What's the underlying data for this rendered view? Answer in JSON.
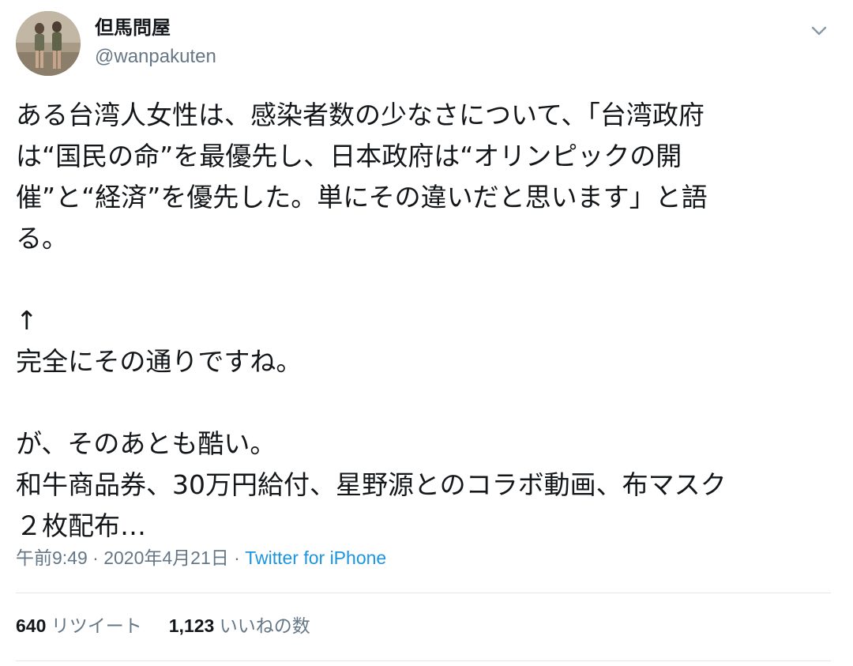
{
  "author": {
    "display_name": "但馬問屋",
    "handle": "@wanpakuten"
  },
  "tweet": {
    "lines": [
      "ある台湾人女性は、感染者数の少なさについて、「台湾政府",
      "は“国民の命”を最優先し、日本政府は“オリンピックの開",
      "催”と“経済”を優先した。単にその違いだと思います」と語",
      "る。",
      "",
      "↑",
      "完全にその通りですね。",
      "",
      "が、そのあとも酷い。",
      "和牛商品券、30万円給付、星野源とのコラボ動画、布マスク",
      "２枚配布…"
    ]
  },
  "meta": {
    "time": "午前9:49",
    "separator1": " · ",
    "date": "2020年4月21日",
    "separator2": " · ",
    "source": "Twitter for iPhone"
  },
  "stats": {
    "retweets_count": "640",
    "retweets_label": "リツイート",
    "likes_count": "1,123",
    "likes_label": "いいねの数"
  },
  "icons": {
    "caret": "chevron-down-icon"
  },
  "colors": {
    "text": "#14171a",
    "secondary": "#657786",
    "link": "#1b95e0",
    "divider": "#e1e8ed"
  }
}
